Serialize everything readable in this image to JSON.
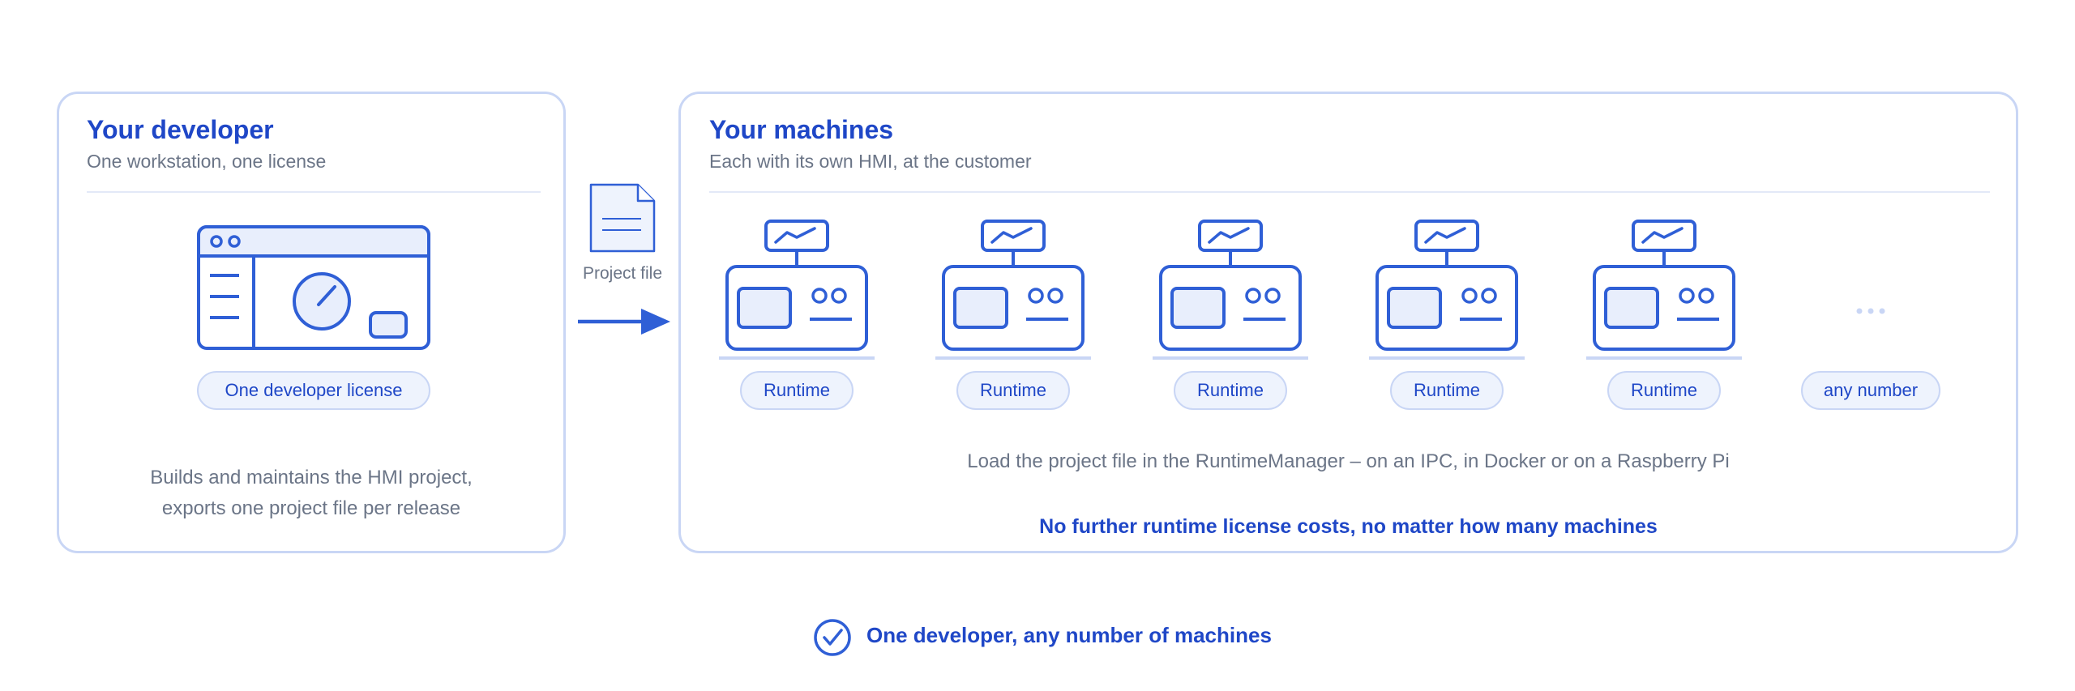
{
  "developer": {
    "title": "Your developer",
    "subtitle": "One workstation, one license",
    "license_pill": "One developer license",
    "description_line1": "Builds and maintains the HMI project,",
    "description_line2": "exports one project file per release"
  },
  "transfer": {
    "label": "Project file"
  },
  "machines": {
    "title": "Your machines",
    "subtitle": "Each with its own HMI, at the customer",
    "runtimes": [
      {
        "label": "Runtime"
      },
      {
        "label": "Runtime"
      },
      {
        "label": "Runtime"
      },
      {
        "label": "Runtime"
      },
      {
        "label": "Runtime"
      }
    ],
    "more_pill": "any number",
    "load_text": "Load the project file in the RuntimeManager – on an IPC, in Docker or on a Raspberry Pi",
    "cost_text": "No further runtime license costs, no matter how many machines"
  },
  "footer": {
    "tagline": "One developer, any number of machines"
  },
  "colors": {
    "accent": "#1f47c7",
    "stroke": "#2f5fd6",
    "fill_light": "#e8eefc",
    "border": "#c9d6f5",
    "muted_text": "#6b7587"
  },
  "icons": {
    "workstation": "hmi-workstation-icon",
    "document": "document-icon",
    "arrow": "arrow-right-icon",
    "machine": "machine-hmi-icon",
    "ellipsis": "ellipsis-icon",
    "check": "check-circle-icon"
  }
}
